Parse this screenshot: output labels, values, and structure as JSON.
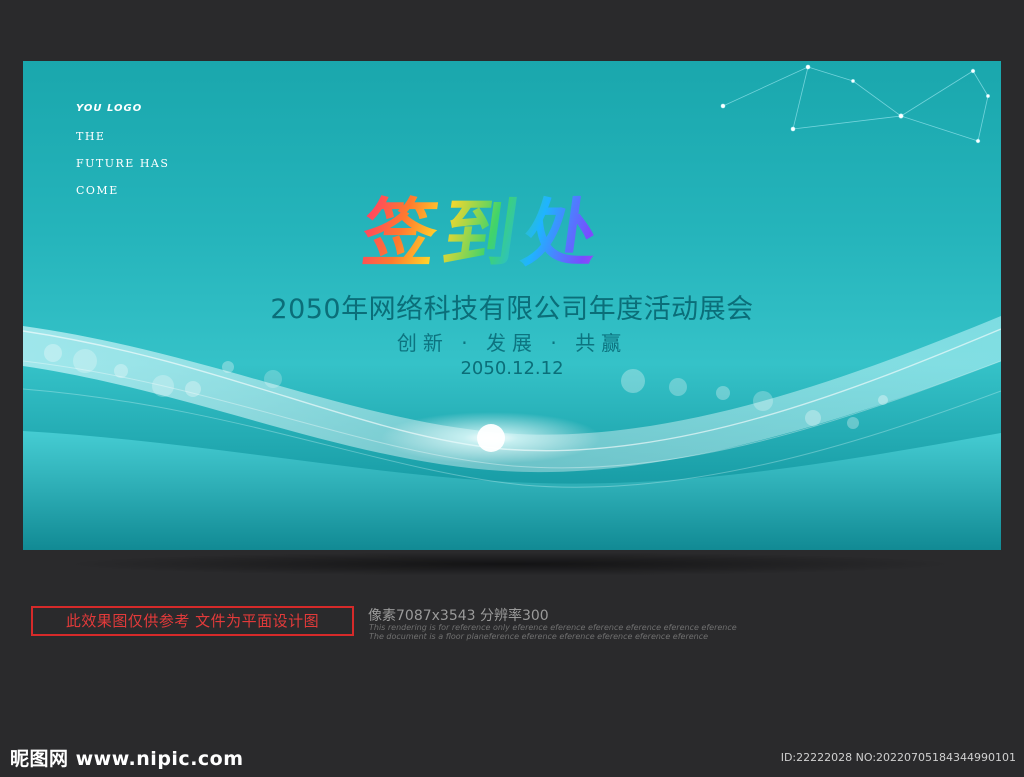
{
  "poster": {
    "logo": "YOU LOGO",
    "tagline": [
      "THE",
      "FUTURE HAS",
      "COME"
    ],
    "headline": "签到处",
    "event_title": "2050年网络科技有限公司年度活动展会",
    "slogan": "创新 · 发展 · 共赢",
    "date": "2050.12.12",
    "colors": {
      "background": "#1fb0b6",
      "title_text": "#0b6e79",
      "headline_gradient": [
        "#ff3b6b",
        "#ffd72a",
        "#40d46a",
        "#1fb4ff",
        "#7a4bff",
        "#e046d8"
      ]
    }
  },
  "footer": {
    "notice": "此效果图仅供参考 文件为平面设计图",
    "resolution": "像素7087x3543  分辨率300",
    "fine_print_1": "This rendering is for reference only  eference eference eference eference eference eference",
    "fine_print_2": "The document is a floor planeference eference eference eference eference eference",
    "site": "昵图网 www.nipic.com",
    "image_id": "ID:22222028 NO:20220705184344990101"
  }
}
